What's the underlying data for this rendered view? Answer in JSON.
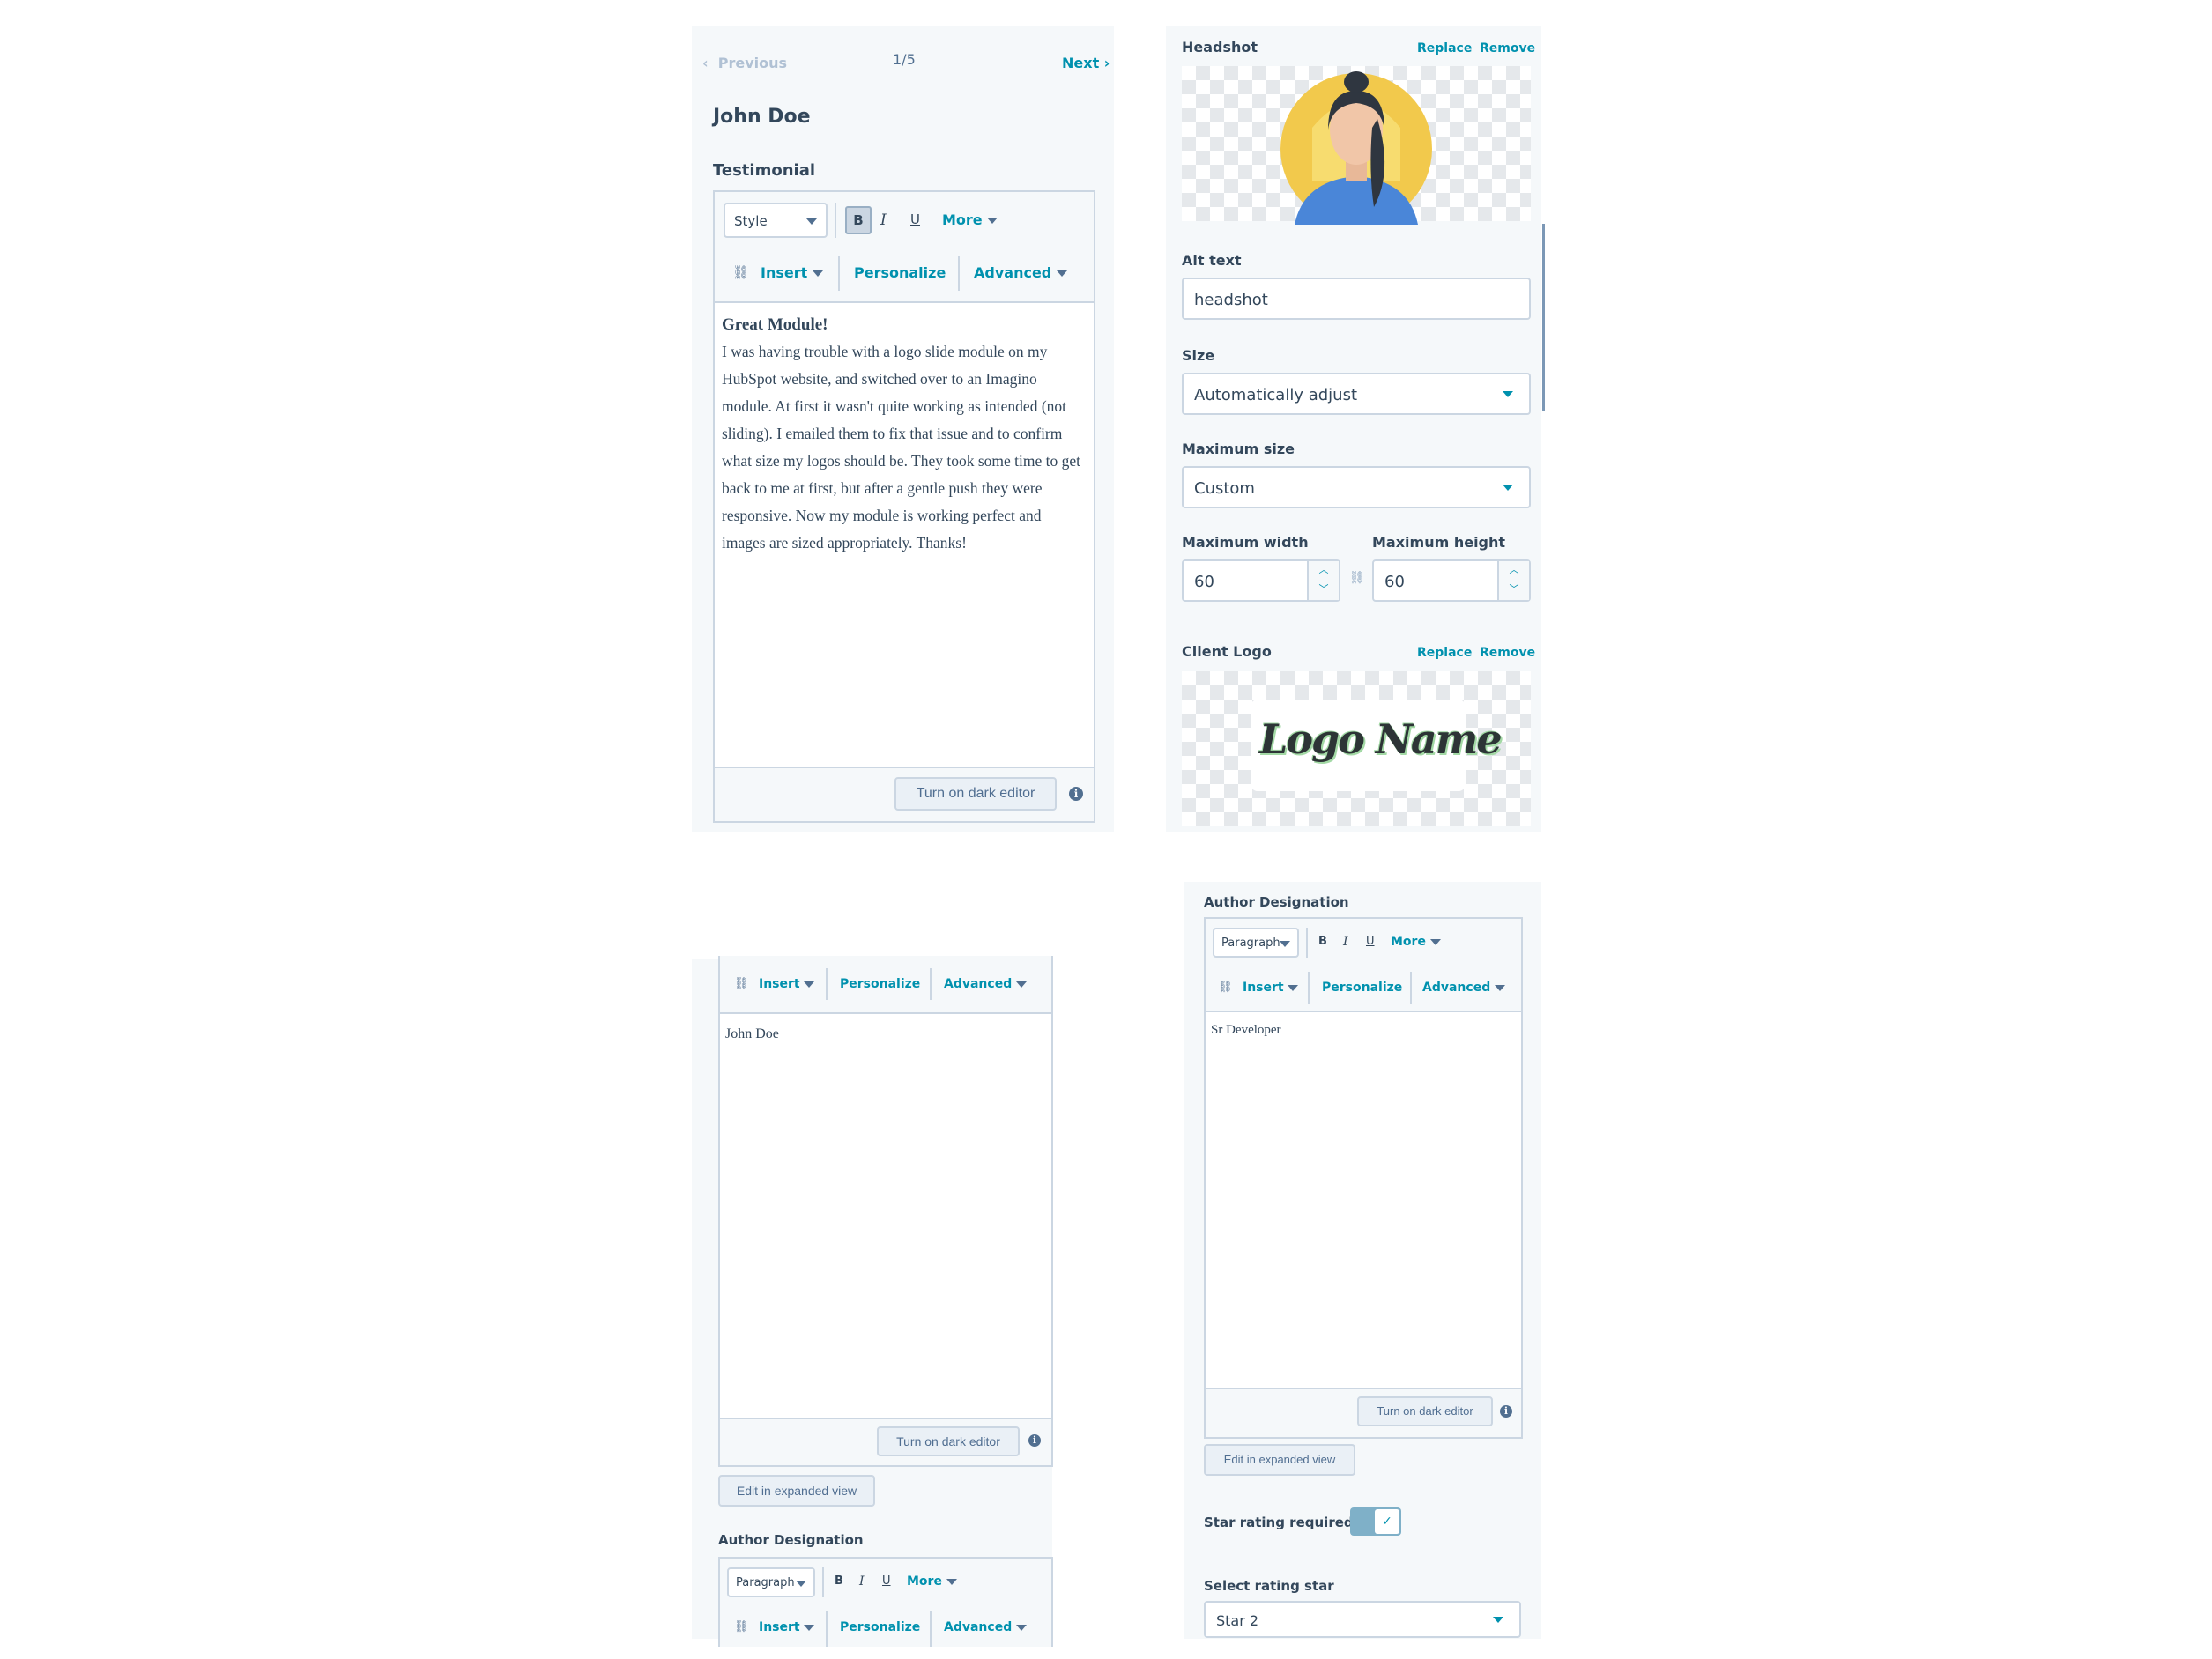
{
  "nav": {
    "previous": "Previous",
    "next": "Next",
    "page": "1/5"
  },
  "item_title": "John Doe",
  "testimonial": {
    "label": "Testimonial",
    "style_select": "Style",
    "bold": "B",
    "italic": "I",
    "underline": "U",
    "more": "More",
    "insert": "Insert",
    "personalize": "Personalize",
    "advanced": "Advanced",
    "heading": "Great Module!",
    "body": "I was having trouble with a logo slide module on my HubSpot website, and switched over to an Imagino module. At first it wasn't quite working as intended (not sliding). I emailed them to fix that issue and to confirm what size my logos should be. They took some time to get back to me at first, but after a gentle push they were responsive. Now my module is working perfect and images are sized appropriately. Thanks!",
    "dark_editor": "Turn on dark editor"
  },
  "headshot": {
    "label": "Headshot",
    "replace": "Replace",
    "remove": "Remove",
    "alt_label": "Alt text",
    "alt_value": "headshot",
    "size_label": "Size",
    "size_value": "Automatically adjust",
    "max_size_label": "Maximum size",
    "max_size_value": "Custom",
    "max_width_label": "Maximum width",
    "max_width_value": "60",
    "max_height_label": "Maximum height",
    "max_height_value": "60"
  },
  "client_logo": {
    "label": "Client Logo",
    "replace": "Replace",
    "remove": "Remove",
    "logo_text": "Logo Name"
  },
  "author_name_editor": {
    "insert": "Insert",
    "personalize": "Personalize",
    "advanced": "Advanced",
    "content": "John Doe",
    "dark_editor": "Turn on dark editor",
    "expanded": "Edit in expanded view"
  },
  "author_designation_left": {
    "label": "Author Designation",
    "paragraph": "Paragraph",
    "bold": "B",
    "italic": "I",
    "underline": "U",
    "more": "More",
    "insert": "Insert",
    "personalize": "Personalize",
    "advanced": "Advanced"
  },
  "author_designation_right": {
    "label": "Author Designation",
    "paragraph": "Paragraph",
    "bold": "B",
    "italic": "I",
    "underline": "U",
    "more": "More",
    "insert": "Insert",
    "personalize": "Personalize",
    "advanced": "Advanced",
    "content": "Sr Developer",
    "dark_editor": "Turn on dark editor",
    "expanded": "Edit in expanded view"
  },
  "star_rating": {
    "required_label": "Star rating required",
    "required_on": true,
    "select_label": "Select rating star",
    "select_value": "Star 2"
  },
  "colors": {
    "accent": "#0091ae",
    "text": "#33475b",
    "border": "#cbd6e2",
    "toggle_on": "#7fb0c8"
  }
}
